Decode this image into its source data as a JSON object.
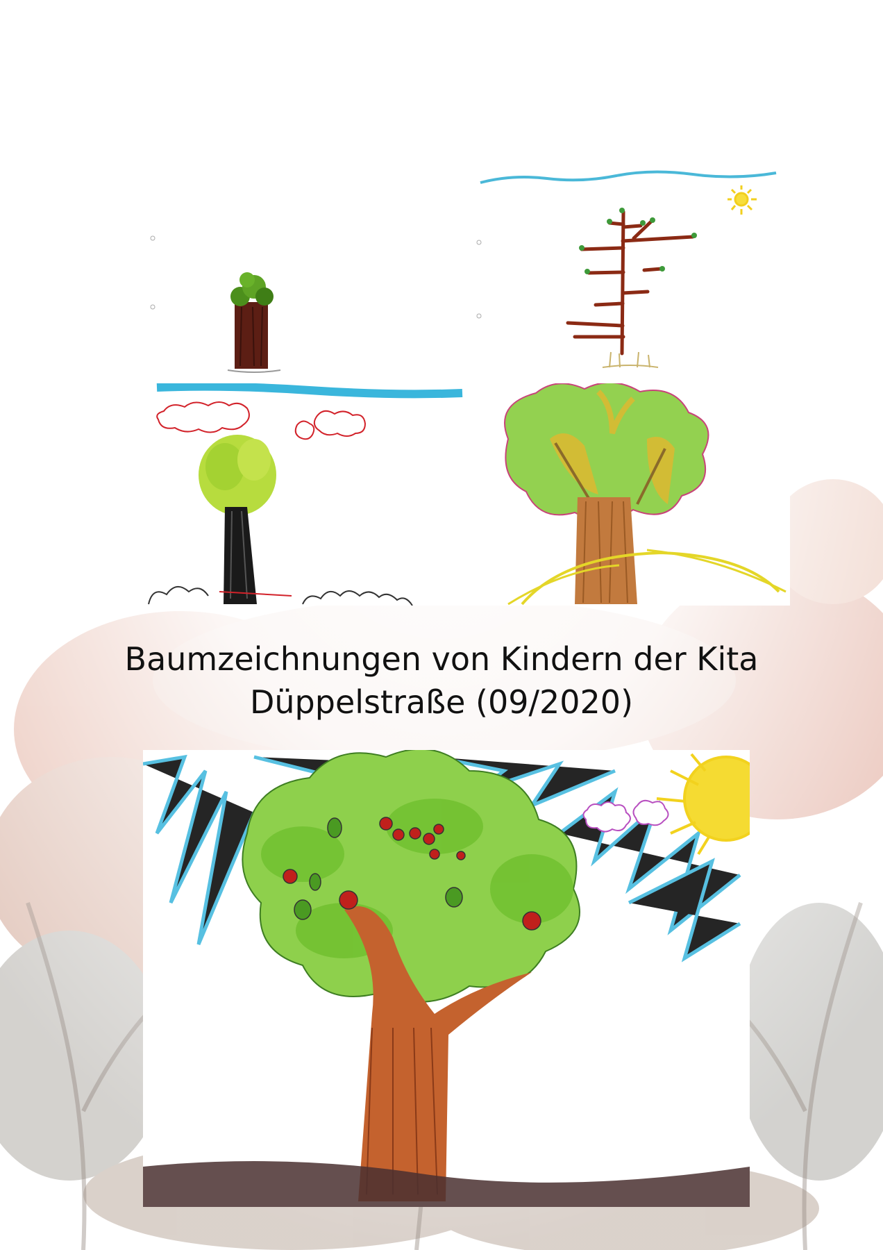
{
  "document": {
    "title_line1": "Baumzeichnungen von Kindern der Kita",
    "title_line2": "Düppelstraße (09/2020)"
  },
  "colors": {
    "sky_blue": "#3ab6dc",
    "leaf_green": "#7cc83c",
    "trunk_brown": "#a0522d",
    "apple_red": "#c0201c",
    "sun_yellow": "#f2d21e",
    "bg_autumn": "#c8573a"
  },
  "drawings": [
    {
      "subject": "small-tree-brown-trunk"
    },
    {
      "subject": "bare-branch-tree-with-sun"
    },
    {
      "subject": "tree-black-trunk-clouds"
    },
    {
      "subject": "large-leafy-tree-on-hill"
    },
    {
      "subject": "apple-tree-with-sun-and-sky"
    }
  ]
}
